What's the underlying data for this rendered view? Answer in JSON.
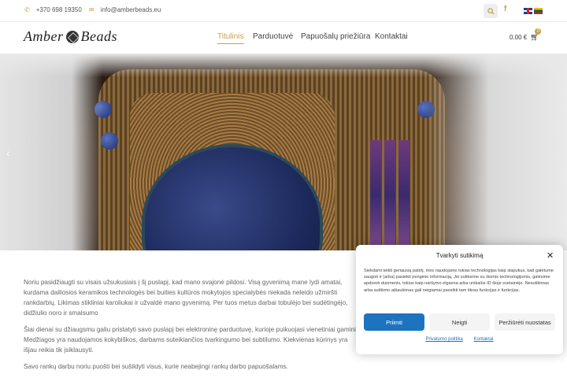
{
  "topbar": {
    "phone": "+370 698 19350",
    "email": "info@amberbeads.eu",
    "phone_icon": "phone-icon",
    "email_icon": "envelope-icon",
    "search_icon": "search-icon",
    "facebook_icon": "facebook-icon",
    "languages": [
      "en-flag-icon",
      "lt-flag-icon"
    ]
  },
  "header": {
    "logo_left": "Amber",
    "logo_right": "Beads",
    "nav": [
      "Titulinis",
      "Parduotuvė",
      "Papuošalų priežiūra",
      "Kontaktai"
    ],
    "cart_total": "0.00 €",
    "cart_count": "0",
    "accent": "#c9a04a"
  },
  "hero": {
    "prev_icon": "chevron-left-icon"
  },
  "content": {
    "p1": "Noriu pasidžiaugti su visais užsukusiais į šį puslapį, kad mano svajonė pildosi. Visą gyvenimą mane lydi amatai, kurdama dailiosios keramikos technologės bei buities kultūros mokytojos specialybės niekada neleido užmiršti rankdarbių. Likimas stikliniai karoliukai ir užvaldė mano gyvenimą. Per tuos metus darbai tobulėjo bei sudėtingėjo, didžiulio noro ir smalsumo",
    "p2": "Šiai dienai su džiaugsmu galiu pristatyti savo puslapį bei elektroninę parduotuvę, kurioje puikuojasi vienetiniai gaminiai Medžiagos yra naudojamos kokybiškos, darbams suteikiančios tvarkingumo bei subtilumo. Kiekvienas kūrinys yra išjau reikia tik įsiklausyti.",
    "p3": "Savo rankų darbu noriu puošti bei sušildyti visus, kurie neabejingi rankų darbo papuošalams."
  },
  "cookie": {
    "title": "Tvarkyti sutikimą",
    "text": "Siekdami teikti geriausią patirtį, mes naudojame tokias technologijas kaip slapukus, kad galėtume saugoti ir (arba) pasiekti įrenginio informaciją. Jei sutiksime su šiomis technologijomis, galėsime apdoroti duomenis, tokius kaip naršymo elgsena arba unikalūs ID šioje svetainėje. Nesutikimas arba sutikimo atšaukimas gali neigiamai paveikti tam tikras funkcijas ir funkcijas.",
    "accept": "Priimti",
    "deny": "Neigti",
    "preferences": "Peržiūrėti nuostatas",
    "privacy_link": "Privatumo politika",
    "contacts_link": "Kontaktai",
    "close_icon": "close-icon",
    "button_color": "#1e73be"
  }
}
